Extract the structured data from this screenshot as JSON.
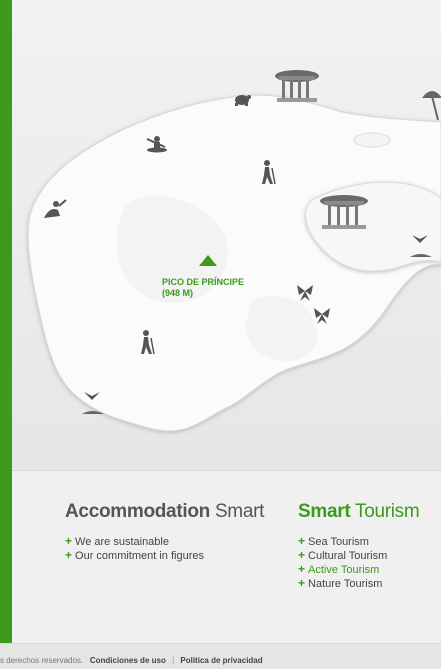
{
  "map": {
    "peak_label_line1": "PICO DE PRÍNCIPE",
    "peak_label_line2": "(948 M)"
  },
  "accommodation": {
    "title_strong": "Accommodation",
    "title_light": "Smart",
    "links": [
      "We are sustainable",
      "Our commitment in figures"
    ]
  },
  "tourism": {
    "title_strong": "Smart",
    "title_light": "Tourism",
    "links": [
      "Sea Tourism",
      "Cultural Tourism",
      "Active Tourism",
      "Nature Tourism"
    ],
    "active_link": "Active Tourism"
  },
  "footer": {
    "rights_text": "s derechos reservados.",
    "terms_link": "Condiciones de uso",
    "separator": "|",
    "privacy_link": "Política de privacidad"
  },
  "colors": {
    "accent_green": "#3d9a1b",
    "text_gray": "#555555"
  }
}
